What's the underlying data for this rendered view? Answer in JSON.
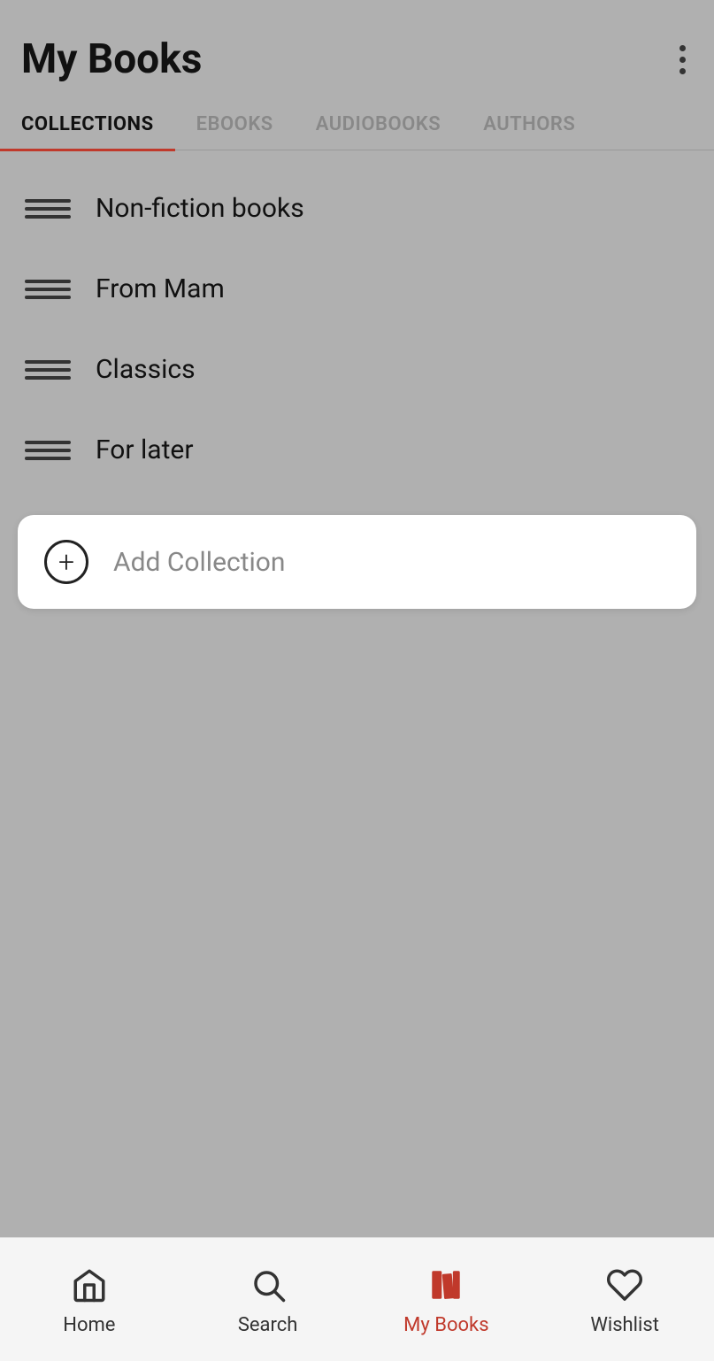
{
  "header": {
    "title": "My Books",
    "menu_icon_label": "more options"
  },
  "tabs": [
    {
      "id": "collections",
      "label": "COLLECTIONS",
      "active": true
    },
    {
      "id": "ebooks",
      "label": "EBOOKS",
      "active": false
    },
    {
      "id": "audiobooks",
      "label": "AUDIOBOOKS",
      "active": false
    },
    {
      "id": "authors",
      "label": "AUTHORS",
      "active": false
    }
  ],
  "collections": [
    {
      "id": "non-fiction",
      "name": "Non-fiction books"
    },
    {
      "id": "from-mam",
      "name": "From Mam"
    },
    {
      "id": "classics",
      "name": "Classics"
    },
    {
      "id": "for-later",
      "name": "For later"
    }
  ],
  "add_collection": {
    "label": "Add Collection"
  },
  "bottom_nav": [
    {
      "id": "home",
      "label": "Home",
      "active": false
    },
    {
      "id": "search",
      "label": "Search",
      "active": false
    },
    {
      "id": "mybooks",
      "label": "My Books",
      "active": true
    },
    {
      "id": "wishlist",
      "label": "Wishlist",
      "active": false
    }
  ],
  "colors": {
    "active_tab_underline": "#c0392b",
    "active_nav_label": "#c0392b"
  }
}
